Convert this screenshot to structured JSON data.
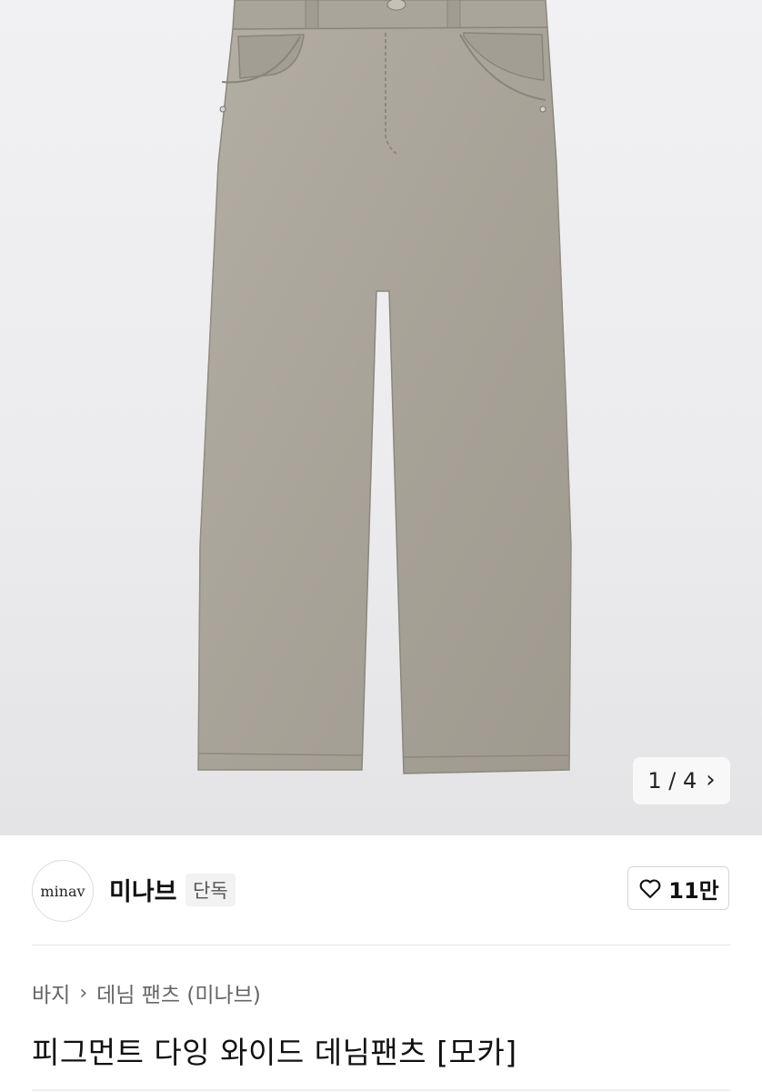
{
  "product_image": {
    "alt": "피그먼트 다잉 와이드 데님팬츠 [모카]",
    "fabric_color": "#a8a398"
  },
  "pager": {
    "text": "1 / 4",
    "current": 1,
    "total": 4,
    "next_icon": "chevron-right-icon"
  },
  "brand": {
    "logo_text": "minav",
    "name": "미나브",
    "badge": "단독"
  },
  "like": {
    "icon": "heart-outline-icon",
    "count": "11만"
  },
  "breadcrumb": {
    "category": "바지",
    "separator_icon": "chevron-right-icon",
    "subcategory": "데님 팬츠 (미나브)"
  },
  "product": {
    "title": "피그먼트 다잉 와이드 데님팬츠 [모카]"
  }
}
